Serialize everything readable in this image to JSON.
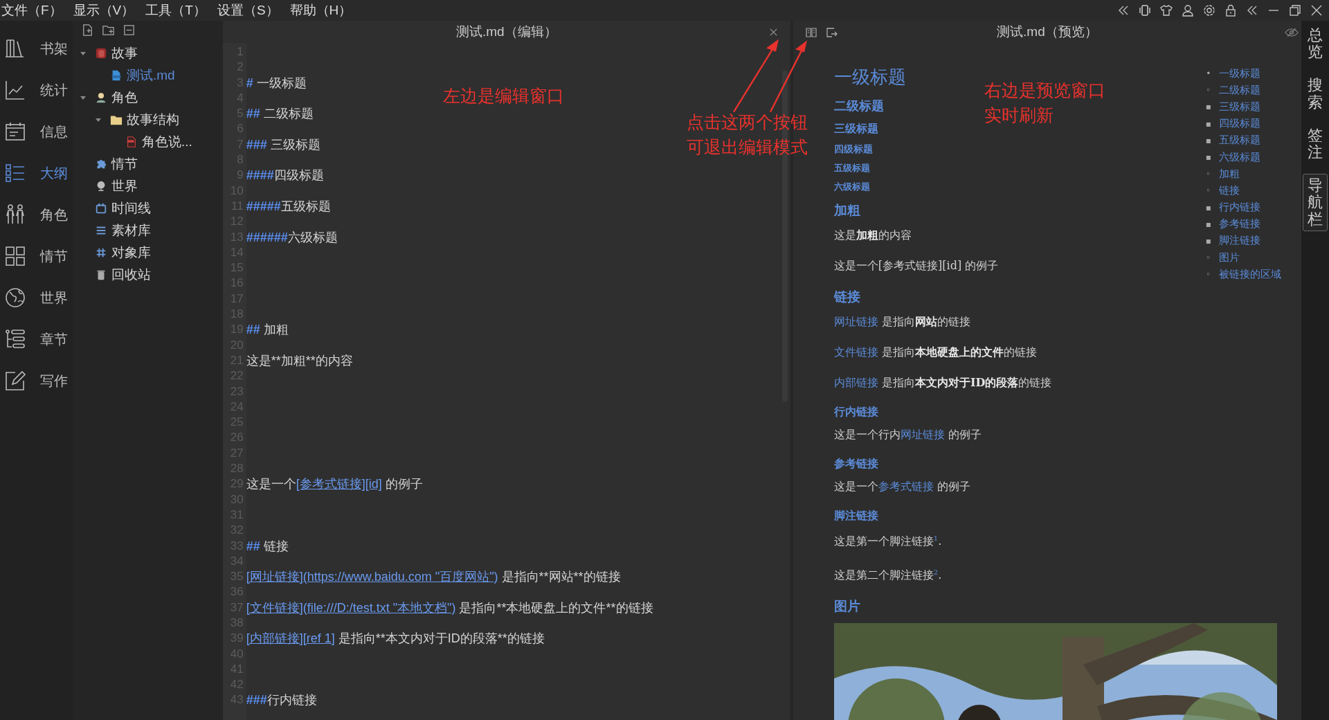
{
  "menu": [
    {
      "label": "文件（F）"
    },
    {
      "label": "显示（V）"
    },
    {
      "label": "工具（T）"
    },
    {
      "label": "设置（S）"
    },
    {
      "label": "帮助（H）"
    }
  ],
  "nav": [
    {
      "label": "书架",
      "kind": "shelf",
      "selected": false
    },
    {
      "label": "统计",
      "kind": "chart",
      "selected": false
    },
    {
      "label": "信息",
      "kind": "calendar",
      "selected": false
    },
    {
      "label": "大纲",
      "kind": "list",
      "selected": true
    },
    {
      "label": "角色",
      "kind": "people",
      "selected": false
    },
    {
      "label": "情节",
      "kind": "grid",
      "selected": false
    },
    {
      "label": "世界",
      "kind": "globe",
      "selected": false
    },
    {
      "label": "章节",
      "kind": "tree",
      "selected": false
    },
    {
      "label": "写作",
      "kind": "edit",
      "selected": false
    }
  ],
  "tree": [
    {
      "label": "故事",
      "kind": "book",
      "expanded": true,
      "selected": false,
      "children": [
        {
          "label": "测试.md",
          "kind": "md",
          "selected": true
        }
      ]
    },
    {
      "label": "角色",
      "kind": "person",
      "expanded": true,
      "selected": false,
      "children": [
        {
          "label": "故事结构",
          "kind": "folder",
          "expanded": true,
          "selected": false,
          "children": [
            {
              "label": "角色说...",
              "kind": "txt",
              "selected": false
            }
          ]
        }
      ]
    },
    {
      "label": "情节",
      "kind": "puzzle",
      "selected": false
    },
    {
      "label": "世界",
      "kind": "globe",
      "selected": false
    },
    {
      "label": "时间线",
      "kind": "calendar",
      "selected": false
    },
    {
      "label": "素材库",
      "kind": "lines",
      "selected": false
    },
    {
      "label": "对象库",
      "kind": "hash",
      "selected": false
    },
    {
      "label": "回收站",
      "kind": "trash",
      "selected": false
    }
  ],
  "editor": {
    "title": "测试.md（编辑）",
    "lines": [
      {
        "number": "1"
      },
      {
        "number": "2"
      },
      {
        "number": "3",
        "parts": [
          {
            "kind": "mark",
            "text": "#"
          },
          {
            "kind": "text",
            "text": " 一级标题"
          }
        ]
      },
      {
        "number": "4"
      },
      {
        "number": "5",
        "parts": [
          {
            "kind": "mark",
            "text": "##"
          },
          {
            "kind": "text",
            "text": " 二级标题"
          }
        ]
      },
      {
        "number": "6"
      },
      {
        "number": "7",
        "parts": [
          {
            "kind": "mark",
            "text": "###"
          },
          {
            "kind": "text",
            "text": " 三级标题"
          }
        ]
      },
      {
        "number": "8"
      },
      {
        "number": "9",
        "parts": [
          {
            "kind": "mark",
            "text": "####"
          },
          {
            "kind": "text",
            "text": "四级标题"
          }
        ]
      },
      {
        "number": "10"
      },
      {
        "number": "11",
        "parts": [
          {
            "kind": "mark",
            "text": "#####"
          },
          {
            "kind": "text",
            "text": "五级标题"
          }
        ]
      },
      {
        "number": "12"
      },
      {
        "number": "13",
        "parts": [
          {
            "kind": "mark",
            "text": "######"
          },
          {
            "kind": "text",
            "text": "六级标题"
          }
        ]
      },
      {
        "number": "14"
      },
      {
        "number": "15"
      },
      {
        "number": "16"
      },
      {
        "number": "17"
      },
      {
        "number": "18"
      },
      {
        "number": "19",
        "parts": [
          {
            "kind": "mark",
            "text": "##"
          },
          {
            "kind": "text",
            "text": " 加粗"
          }
        ]
      },
      {
        "number": "20"
      },
      {
        "number": "21",
        "parts": [
          {
            "kind": "text",
            "text": "这是**加粗**的内容"
          }
        ]
      },
      {
        "number": "22"
      },
      {
        "number": "23"
      },
      {
        "number": "24"
      },
      {
        "number": "25"
      },
      {
        "number": "26"
      },
      {
        "number": "27"
      },
      {
        "number": "28"
      },
      {
        "number": "29",
        "parts": [
          {
            "kind": "text",
            "text": "这是一个"
          },
          {
            "kind": "link",
            "text": "[参考式链接][id]"
          },
          {
            "kind": "text",
            "text": " 的例子"
          }
        ]
      },
      {
        "number": "30"
      },
      {
        "number": "31"
      },
      {
        "number": "32"
      },
      {
        "number": "33",
        "parts": [
          {
            "kind": "mark",
            "text": "##"
          },
          {
            "kind": "text",
            "text": " 链接"
          }
        ]
      },
      {
        "number": "34"
      },
      {
        "number": "35",
        "parts": [
          {
            "kind": "link",
            "text": "[网址链接](https://www.baidu.com \"百度网站\")"
          },
          {
            "kind": "text",
            "text": " 是指向**网站**的链接"
          }
        ]
      },
      {
        "number": "36"
      },
      {
        "number": "37",
        "parts": [
          {
            "kind": "link",
            "text": "[文件链接](file:///D:/test.txt \"本地文档\")"
          },
          {
            "kind": "text",
            "text": " 是指向**本地硬盘上的文件**的链接"
          }
        ]
      },
      {
        "number": "38"
      },
      {
        "number": "39",
        "parts": [
          {
            "kind": "link",
            "text": "[内部链接][ref 1]"
          },
          {
            "kind": "text",
            "text": " 是指向**本文内对于ID的段落**的链接"
          }
        ]
      },
      {
        "number": "40"
      },
      {
        "number": "41"
      },
      {
        "number": "42"
      },
      {
        "number": "43",
        "parts": [
          {
            "kind": "mark",
            "text": "###"
          },
          {
            "kind": "text",
            "text": "行内链接"
          }
        ]
      }
    ]
  },
  "preview": {
    "title": "测试.md（预览）",
    "blocks": [
      {
        "kind": "h1",
        "text": "一级标题"
      },
      {
        "kind": "h2",
        "text": "二级标题"
      },
      {
        "kind": "h3",
        "text": "三级标题"
      },
      {
        "kind": "h4",
        "text": "四级标题"
      },
      {
        "kind": "h5",
        "text": "五级标题"
      },
      {
        "kind": "h6",
        "text": "六级标题"
      },
      {
        "kind": "h2",
        "text": "加粗"
      },
      {
        "kind": "p",
        "parts": [
          {
            "kind": "text",
            "text": "这是**加粗**的内容"
          }
        ]
      },
      {
        "kind": "p",
        "parts": [
          {
            "kind": "text",
            "text": "这是一个[参考式链接][id] 的例子"
          }
        ]
      },
      {
        "kind": "h2",
        "text": "链接"
      },
      {
        "kind": "p",
        "parts": [
          {
            "kind": "link",
            "text": "网址链接"
          },
          {
            "kind": "text",
            "text": " 是指向**网站**的链接"
          }
        ]
      },
      {
        "kind": "p",
        "parts": [
          {
            "kind": "link",
            "text": "文件链接"
          },
          {
            "kind": "text",
            "text": " 是指向**本地硬盘上的文件**的链接"
          }
        ]
      },
      {
        "kind": "p",
        "parts": [
          {
            "kind": "link",
            "text": "内部链接"
          },
          {
            "kind": "text",
            "text": " 是指向**本文内对于ID的段落**的链接"
          }
        ]
      },
      {
        "kind": "h3",
        "text": "行内链接"
      },
      {
        "kind": "p",
        "parts": [
          {
            "kind": "text",
            "text": "这是一个行内"
          },
          {
            "kind": "link",
            "text": "网址链接"
          },
          {
            "kind": "text",
            "text": " 的例子"
          }
        ]
      },
      {
        "kind": "h3",
        "text": "参考链接"
      },
      {
        "kind": "p",
        "parts": [
          {
            "kind": "text",
            "text": "这是一个"
          },
          {
            "kind": "link",
            "text": "参考式链接"
          },
          {
            "kind": "text",
            "text": " 的例子"
          }
        ]
      },
      {
        "kind": "h3",
        "text": "脚注链接"
      },
      {
        "kind": "p",
        "parts": [
          {
            "kind": "text",
            "text": "这是第一个脚注链接$^{1}$."
          }
        ]
      },
      {
        "kind": "p",
        "parts": [
          {
            "kind": "text",
            "text": "这是第二个脚注链接$^{2}$."
          }
        ]
      },
      {
        "kind": "h2",
        "text": "图片"
      },
      {
        "kind": "picture"
      }
    ]
  },
  "toc": [
    {
      "label": "一级标题",
      "bullet": "•"
    },
    {
      "label": "二级标题",
      "bullet": "◦"
    },
    {
      "label": "三级标题",
      "bullet": "▪"
    },
    {
      "label": "四级标题",
      "bullet": "▪"
    },
    {
      "label": "五级标题",
      "bullet": "▪"
    },
    {
      "label": "六级标题",
      "bullet": "▪"
    },
    {
      "label": "加粗",
      "bullet": "◦"
    },
    {
      "label": "链接",
      "bullet": "◦"
    },
    {
      "label": "行内链接",
      "bullet": "▪"
    },
    {
      "label": "参考链接",
      "bullet": "▪"
    },
    {
      "label": "脚注链接",
      "bullet": "▪"
    },
    {
      "label": "图片",
      "bullet": "◦"
    },
    {
      "label": "被链接的区域",
      "bullet": "◦"
    }
  ],
  "side_tabs": [
    {
      "label": "总览",
      "selected": false
    },
    {
      "label": "搜索",
      "selected": false
    },
    {
      "label": "签注",
      "selected": false
    },
    {
      "label": "导航栏",
      "selected": true
    }
  ],
  "annotations": [
    {
      "lines": [
        "左边是编辑窗口"
      ]
    },
    {
      "lines": [
        "点击这两个按钮",
        "可退出编辑模式"
      ]
    },
    {
      "lines": [
        "右边是预览窗口",
        "实时刷新"
      ]
    }
  ]
}
